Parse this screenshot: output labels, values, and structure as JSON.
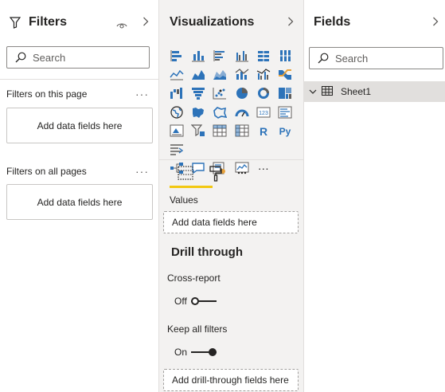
{
  "filters": {
    "title": "Filters",
    "search_placeholder": "Search",
    "page_section": "Filters on this page",
    "page_drop": "Add data fields here",
    "all_section": "Filters on all pages",
    "all_drop": "Add data fields here",
    "more": "···"
  },
  "viz": {
    "title": "Visualizations",
    "more_visuals": "···",
    "values_label": "Values",
    "values_drop": "Add data fields here",
    "drill_title": "Drill through",
    "cross_report_label": "Cross-report",
    "cross_report_state": "Off",
    "keep_filters_label": "Keep all filters",
    "keep_filters_state": "On",
    "drill_drop": "Add drill-through fields here",
    "accent": "#f2c811",
    "icon_blue": "#2d73b9"
  },
  "fields": {
    "title": "Fields",
    "search_placeholder": "Search",
    "tables": [
      {
        "name": "Sheet1"
      }
    ]
  }
}
